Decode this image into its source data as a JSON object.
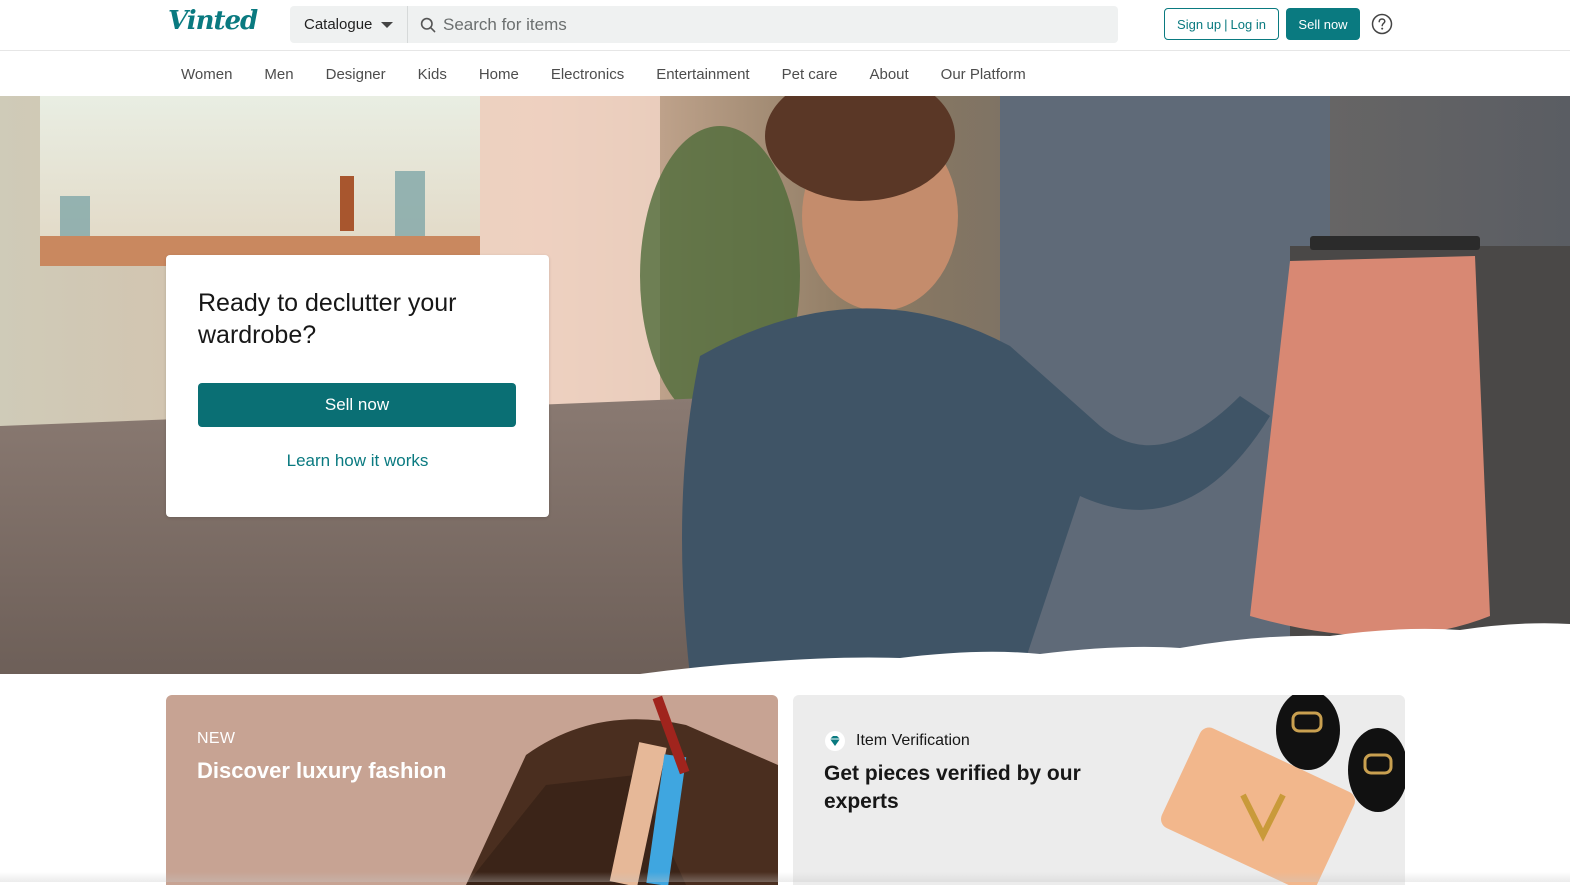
{
  "header": {
    "logo": "Vinted",
    "catalogue_label": "Catalogue",
    "search_placeholder": "Search for items",
    "signup_label": "Sign up",
    "signup_separator": "|",
    "login_label": "Log in",
    "sell_label": "Sell now",
    "help_icon": "help-circle-icon",
    "search_icon": "search-icon"
  },
  "nav": {
    "items": [
      "Women",
      "Men",
      "Designer",
      "Kids",
      "Home",
      "Electronics",
      "Entertainment",
      "Pet care",
      "About",
      "Our Platform"
    ]
  },
  "hero": {
    "title": "Ready to declutter your wardrobe?",
    "sell_button": "Sell now",
    "learn_link": "Learn how it works"
  },
  "promos": {
    "luxury": {
      "tag": "NEW",
      "title": "Discover luxury fashion"
    },
    "verification": {
      "badge": "Item Verification",
      "icon": "diamond-icon",
      "title": "Get pieces verified by our experts"
    }
  },
  "colors": {
    "brand": "#0a7a80",
    "brand_dark": "#0a6f74",
    "luxury_bg": "#c7a393",
    "verify_bg": "#ececec"
  }
}
